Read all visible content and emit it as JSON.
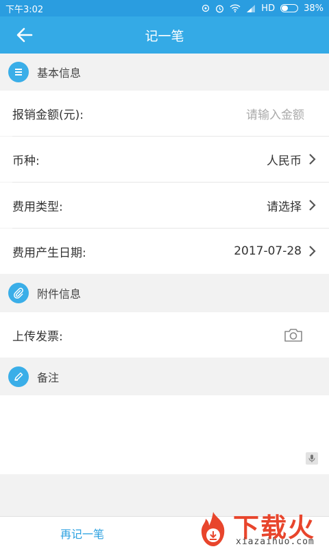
{
  "status": {
    "time": "下午3:02",
    "network": "HD",
    "battery": "38%",
    "battery_level": 0.38
  },
  "header": {
    "title": "记一笔"
  },
  "sections": {
    "basic": "基本信息",
    "attachment": "附件信息",
    "remark": "备注"
  },
  "fields": {
    "amount": {
      "label": "报销金额(元):",
      "placeholder": "请输入金额"
    },
    "currency": {
      "label": "币种:",
      "value": "人民币"
    },
    "expense_type": {
      "label": "费用类型:",
      "value": "请选择"
    },
    "date": {
      "label": "费用产生日期:",
      "value": "2017-07-28"
    },
    "invoice": {
      "label": "上传发票:"
    }
  },
  "footer": {
    "again_label": "再记一笔"
  },
  "watermark": {
    "brand": "下载火",
    "url": "xiazaihuo.com"
  },
  "colors": {
    "accent": "#34aae6",
    "statusbar": "#2a9de0",
    "brand": "#e8452c"
  }
}
